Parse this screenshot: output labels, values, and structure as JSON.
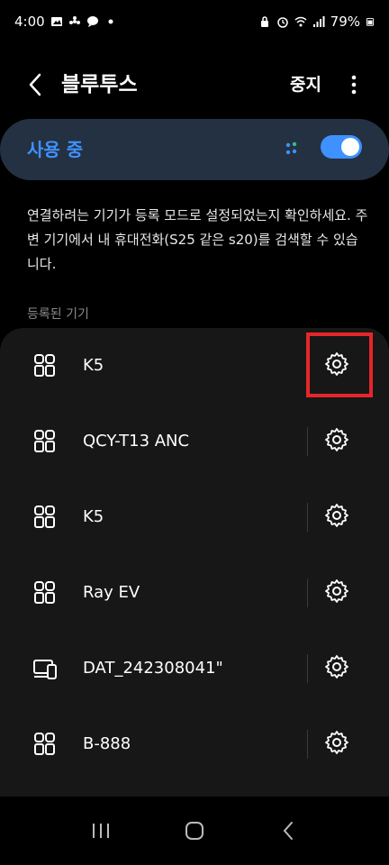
{
  "status_bar": {
    "time": "4:00",
    "battery": "79%"
  },
  "header": {
    "title": "블루투스",
    "stop_label": "중지"
  },
  "toggle": {
    "label": "사용 중",
    "on": true
  },
  "description": "연결하려는 기기가 등록 모드로 설정되었는지 확인하세요. 주변 기기에서 내 휴대전화(S25 같은 s20)를 검색할 수 있습니다.",
  "section_label": "등록된 기기",
  "devices": [
    {
      "name": "K5",
      "icon": "earbuds-icon"
    },
    {
      "name": "QCY-T13 ANC",
      "icon": "earbuds-icon"
    },
    {
      "name": "K5",
      "icon": "earbuds-icon"
    },
    {
      "name": "Ray EV",
      "icon": "earbuds-icon"
    },
    {
      "name": "DAT_242308041\"",
      "icon": "computer-phone-icon"
    },
    {
      "name": "B-888",
      "icon": "earbuds-icon"
    }
  ],
  "colors": {
    "accent": "#3e91ff",
    "toggle_card_bg": "#243142",
    "list_bg": "#171717",
    "highlight": "#e6262a"
  }
}
